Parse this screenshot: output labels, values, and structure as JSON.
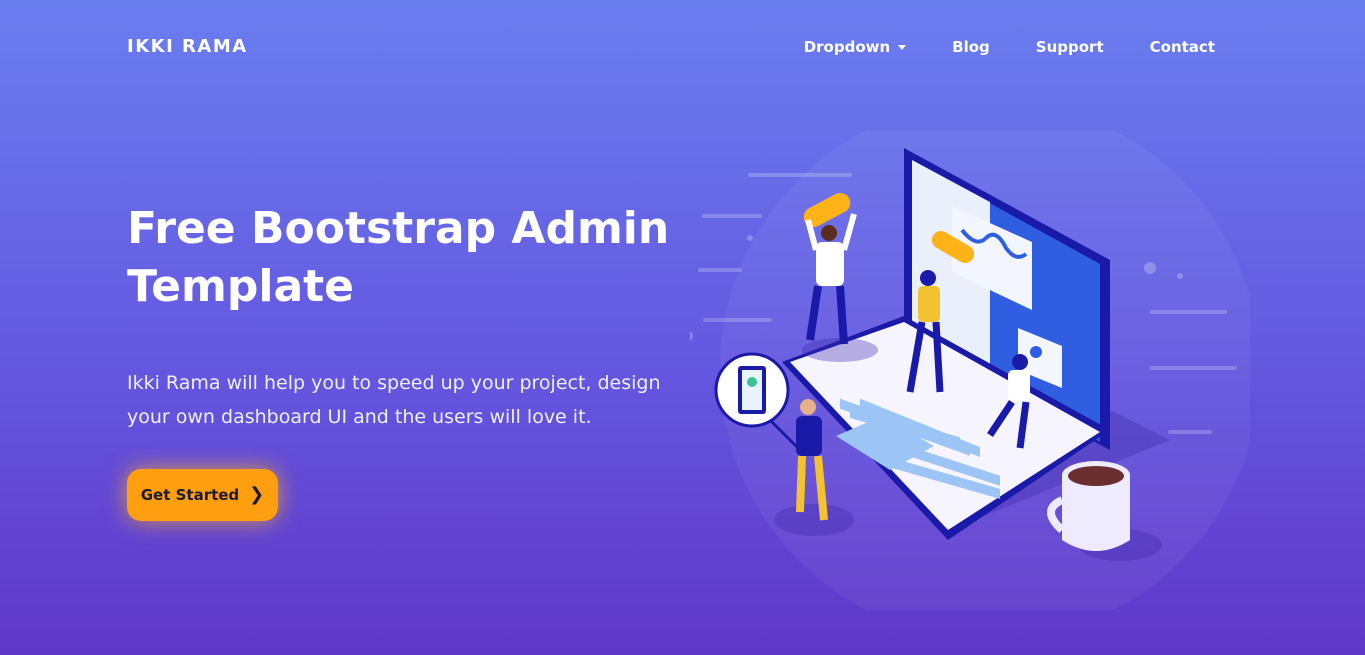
{
  "brand": {
    "name": "IKKI RAMA"
  },
  "nav": {
    "items": [
      {
        "label": "Dropdown"
      },
      {
        "label": "Blog"
      },
      {
        "label": "Support"
      },
      {
        "label": "Contact"
      }
    ]
  },
  "hero": {
    "title": "Free Bootstrap Admin Template",
    "description": "Ikki Rama will help you to speed up your project, design your own dashboard UI and the users will love it.",
    "cta_label": "Get Started",
    "cta_icon": "chevron-right-icon"
  },
  "colors": {
    "background_top": "#6a7ef0",
    "background_bottom": "#5f37c8",
    "accent": "#ff9f0f",
    "text": "#ffffff"
  }
}
